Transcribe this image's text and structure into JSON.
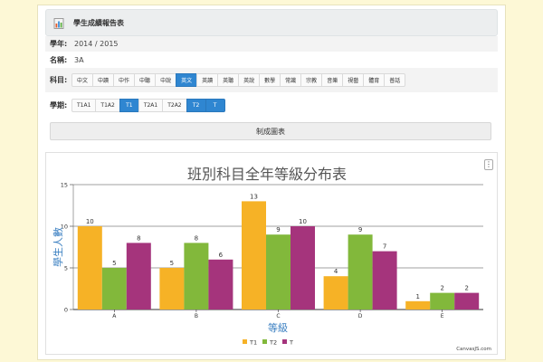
{
  "header": {
    "title": "學生成績報告表",
    "icon": "report-icon"
  },
  "form": {
    "year": {
      "label": "學年:",
      "value": "2014 / 2015"
    },
    "name": {
      "label": "名稱:",
      "value": "3A"
    },
    "subject": {
      "label": "科目:",
      "options": [
        "中文",
        "中讀",
        "中作",
        "中聽",
        "中說",
        "英文",
        "英讀",
        "英聽",
        "英說",
        "數學",
        "常識",
        "宗教",
        "音樂",
        "視藝",
        "體育",
        "普話"
      ],
      "selected": "英文"
    },
    "term": {
      "label": "學期:",
      "options": [
        "T1A1",
        "T1A2",
        "T1",
        "T2A1",
        "T2A2",
        "T2",
        "T"
      ],
      "selected": [
        "T1",
        "T2",
        "T"
      ]
    },
    "generate_label": "制成圖表"
  },
  "chart_menu_glyph": "⋮",
  "chart_data": {
    "type": "bar",
    "title": "班別科目全年等級分布表",
    "xlabel": "等級",
    "ylabel": "學生人數",
    "categories": [
      "A",
      "B",
      "C",
      "D",
      "E"
    ],
    "series": [
      {
        "name": "T1",
        "color": "#f6b226",
        "values": [
          10,
          5,
          13,
          4,
          1
        ]
      },
      {
        "name": "T2",
        "color": "#82b83b",
        "values": [
          5,
          8,
          9,
          9,
          2
        ]
      },
      {
        "name": "T",
        "color": "#a5347c",
        "values": [
          8,
          6,
          10,
          7,
          2
        ]
      }
    ],
    "ylim": [
      0,
      15
    ],
    "yticks": [
      0,
      5,
      10,
      15
    ],
    "grid": true,
    "legend": "bottom",
    "credit": "CanvasJS.com"
  },
  "colors": {
    "accent": "#2f86d1",
    "background": "#fdf8d6"
  }
}
